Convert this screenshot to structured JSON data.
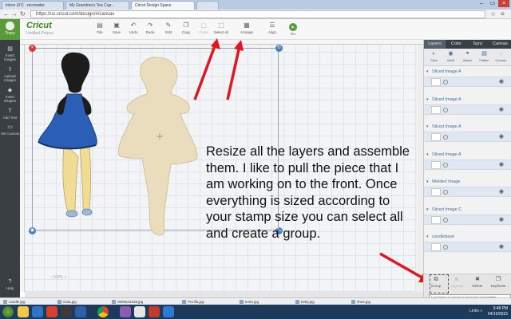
{
  "browser": {
    "tabs": [
      {
        "label": "Inbox (47) - mcrowder"
      },
      {
        "label": "My Grandma's Tea Cup..."
      },
      {
        "label": "Cricut Design Space"
      },
      {
        "label": ""
      }
    ],
    "url": "https://us.cricut.com/design/#/canvas"
  },
  "app": {
    "brand": "Cricut",
    "project_name": "Untitled Project",
    "account_label": "Tracy",
    "toolbar": [
      {
        "label": "File",
        "icon": "folder-icon",
        "glyph": "▤"
      },
      {
        "label": "Save",
        "icon": "save-icon",
        "glyph": "▣"
      },
      {
        "label": "Undo",
        "icon": "undo-icon",
        "glyph": "↶"
      },
      {
        "label": "Redo",
        "icon": "redo-icon",
        "glyph": "↷"
      },
      {
        "label": "Edit",
        "icon": "edit-icon",
        "glyph": "✎"
      },
      {
        "label": "Copy",
        "icon": "copy-icon",
        "glyph": "❐"
      },
      {
        "label": "Paste",
        "icon": "paste-icon",
        "glyph": "▢",
        "dim": true
      },
      {
        "label": "Select All",
        "icon": "select-all-icon",
        "glyph": "⬚"
      },
      {
        "label": "Arrange",
        "icon": "arrange-icon",
        "glyph": "▦"
      },
      {
        "label": "Align",
        "icon": "align-icon",
        "glyph": "☰"
      }
    ],
    "go_label": "Go",
    "sidebar": [
      {
        "label": "Insert Images",
        "icon": "images-icon",
        "glyph": "▨"
      },
      {
        "label": "Upload Images",
        "icon": "upload-icon",
        "glyph": "⇪"
      },
      {
        "label": "Insert Shapes",
        "icon": "shapes-icon",
        "glyph": "◆"
      },
      {
        "label": "Add Text",
        "icon": "text-icon",
        "glyph": "T"
      },
      {
        "label": "Set Canvas",
        "icon": "canvas-icon",
        "glyph": "▭"
      }
    ],
    "help_label": "Help",
    "zoom_label": "100%"
  },
  "panel": {
    "tabs": [
      "Layers",
      "Color",
      "Sync",
      "Canvas"
    ],
    "tools": [
      {
        "label": "Slice",
        "icon": "slice-icon",
        "glyph": "◐"
      },
      {
        "label": "Weld",
        "icon": "weld-icon",
        "glyph": "◉"
      },
      {
        "label": "Attach",
        "icon": "attach-icon",
        "glyph": "⚭"
      },
      {
        "label": "Flatten",
        "icon": "flatten-icon",
        "glyph": "▤"
      },
      {
        "label": "Contour",
        "icon": "contour-icon",
        "glyph": "◌"
      }
    ],
    "layers": [
      {
        "name": "Sliced Image A"
      },
      {
        "name": "Sliced Image A"
      },
      {
        "name": "Sliced Image A"
      },
      {
        "name": "Sliced Image A"
      },
      {
        "name": "Welded Image"
      },
      {
        "name": "Sliced Image C"
      },
      {
        "name": "candlebase"
      }
    ],
    "bottom": [
      {
        "label": "Group",
        "icon": "group-icon",
        "glyph": "⧉"
      },
      {
        "label": "Ungroup",
        "icon": "ungroup-icon",
        "glyph": "⧈",
        "dim": true
      },
      {
        "label": "Delete",
        "icon": "delete-icon",
        "glyph": "🗑"
      },
      {
        "label": "Duplicate",
        "icon": "duplicate-icon",
        "glyph": "❐"
      }
    ],
    "tooltip": "Lock layers on canvas to move and use together"
  },
  "downloads": [
    "candle.jpg",
    "Gola.jpg",
    "0000523428.jpg",
    "Pricilla.jpg",
    "teola.jpg",
    "betty.jpg",
    "shoe.jpg"
  ],
  "taskbar": {
    "tray": "Links »",
    "time": "3:48 PM",
    "date": "04/10/2015"
  },
  "annotation": "Resize all the layers and assemble them. I like to pull the piece that I am working on to the front. Once everything is sized according to your stamp size you can select all and create a group.",
  "colors": {
    "accent_green": "#5a9a3a",
    "arrow_red": "#e1161f",
    "dress_blue": "#2a5fb5",
    "hair_black": "#1c1c1c",
    "skin": "#f0dc95",
    "tan_silhouette": "#e9ddbd"
  }
}
